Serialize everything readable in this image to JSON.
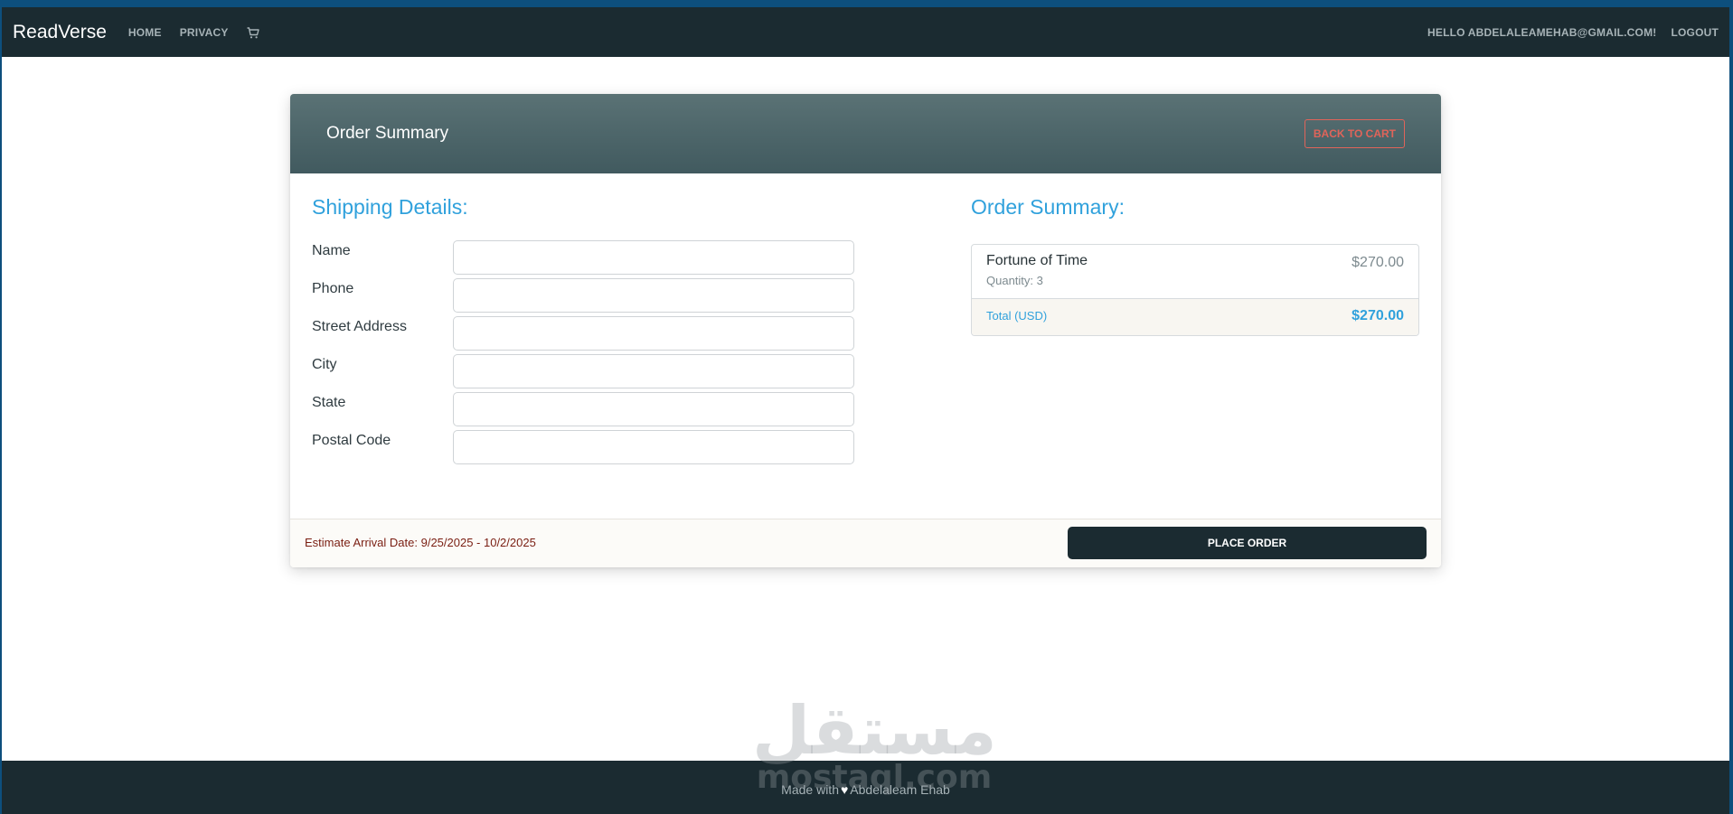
{
  "navbar": {
    "brand": "ReadVerse",
    "links": [
      "HOME",
      "PRIVACY"
    ],
    "cart_icon": "cart-icon",
    "greeting": "HELLO ABDELALEAMEHAB@GMAIL.COM!",
    "logout": "LOGOUT"
  },
  "card": {
    "title": "Order Summary",
    "back_button": "BACK TO CART"
  },
  "shipping": {
    "title": "Shipping Details:",
    "fields": [
      {
        "label": "Name",
        "value": ""
      },
      {
        "label": "Phone",
        "value": ""
      },
      {
        "label": "Street Address",
        "value": ""
      },
      {
        "label": "City",
        "value": ""
      },
      {
        "label": "State",
        "value": ""
      },
      {
        "label": "Postal Code",
        "value": ""
      }
    ]
  },
  "order_summary": {
    "title": "Order Summary:",
    "items": [
      {
        "name": "Fortune of Time",
        "quantity": "Quantity: 3",
        "price": "$270.00"
      }
    ],
    "total_label": "Total (USD)",
    "total_value": "$270.00"
  },
  "card_footer": {
    "arrival": "Estimate Arrival Date: 9/25/2025 - 10/2/2025",
    "place_order": "PLACE ORDER"
  },
  "footer": {
    "made_with": "Made with",
    "heart_icon": "heart-icon",
    "author": "Abdelaleam Ehab"
  },
  "watermark": {
    "arabic": "مستقل",
    "latin": "mostaql.com"
  },
  "colors": {
    "navbar_bg": "#1b2b31",
    "accent_blue": "#30a1dc",
    "danger": "#e0645a",
    "arrival_text": "#7a1e12",
    "header_gradient_top": "#5a7275",
    "header_gradient_bottom": "#415a5f"
  }
}
